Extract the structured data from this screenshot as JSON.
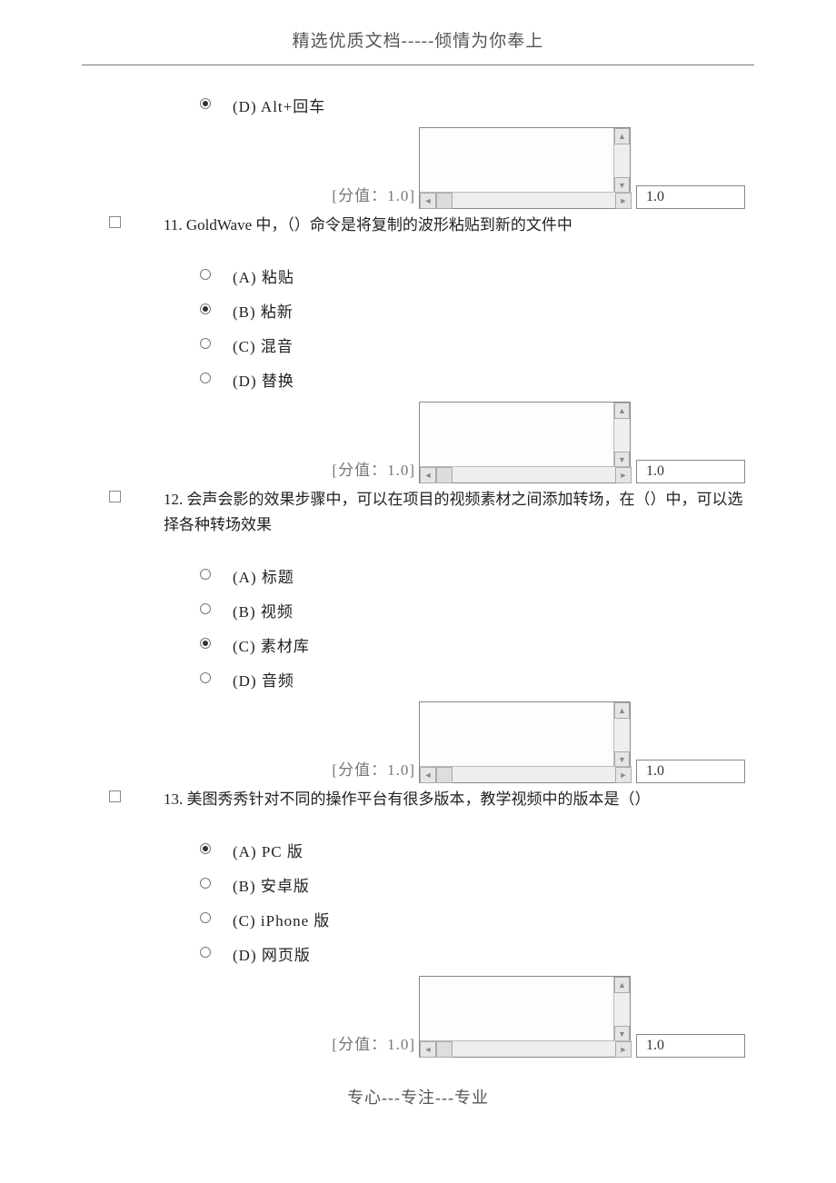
{
  "header": "精选优质文档-----倾情为你奉上",
  "footer": "专心---专注---专业",
  "score_label": "[分值：1.0]",
  "score_value": "1.0",
  "q10_tail": {
    "options": [
      {
        "key": "(D)",
        "text": "Alt+回车",
        "selected": true
      }
    ]
  },
  "questions": [
    {
      "num": "11.",
      "text": "GoldWave 中，（）命令是将复制的波形粘贴到新的文件中",
      "options": [
        {
          "key": "(A)",
          "text": "粘贴",
          "selected": false
        },
        {
          "key": "(B)",
          "text": "粘新",
          "selected": true
        },
        {
          "key": "(C)",
          "text": "混音",
          "selected": false
        },
        {
          "key": "(D)",
          "text": "替换",
          "selected": false
        }
      ]
    },
    {
      "num": "12.",
      "text": "会声会影的效果步骤中，可以在项目的视频素材之间添加转场，在（）中，可以选择各种转场效果",
      "options": [
        {
          "key": "(A)",
          "text": "标题",
          "selected": false
        },
        {
          "key": "(B)",
          "text": "视频",
          "selected": false
        },
        {
          "key": "(C)",
          "text": "素材库",
          "selected": true
        },
        {
          "key": "(D)",
          "text": "音频",
          "selected": false
        }
      ]
    },
    {
      "num": "13.",
      "text": "美图秀秀针对不同的操作平台有很多版本，教学视频中的版本是（）",
      "options": [
        {
          "key": "(A)",
          "text": "PC 版",
          "selected": true
        },
        {
          "key": "(B)",
          "text": "安卓版",
          "selected": false
        },
        {
          "key": "(C)",
          "text": "iPhone 版",
          "selected": false
        },
        {
          "key": "(D)",
          "text": "网页版",
          "selected": false
        }
      ]
    }
  ]
}
